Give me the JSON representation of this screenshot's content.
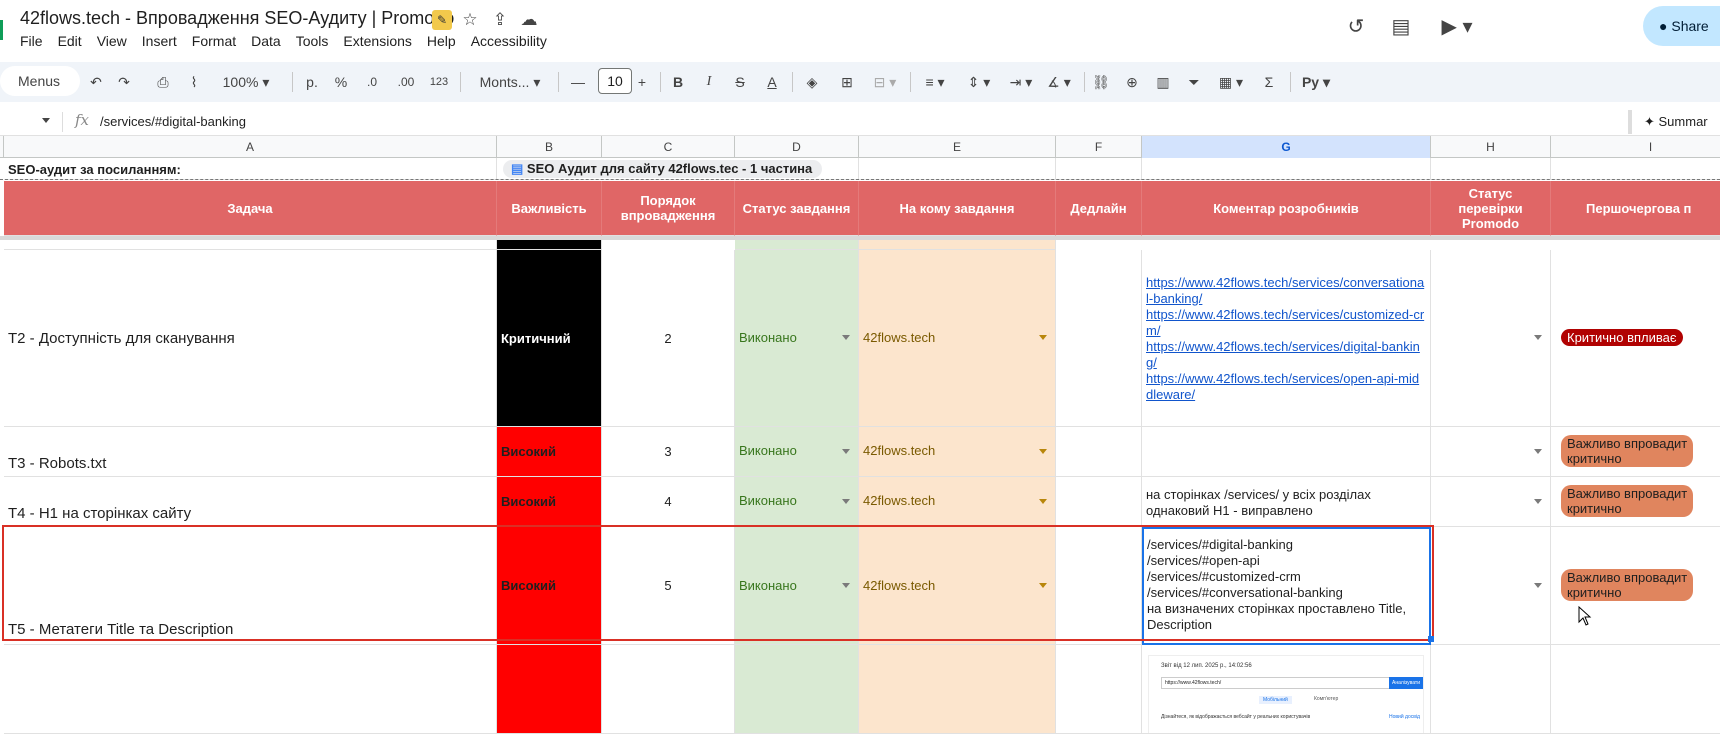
{
  "title": "42flows.tech - Впровадження SEO-Аудиту | Promodo",
  "menu": [
    "File",
    "Edit",
    "View",
    "Insert",
    "Format",
    "Data",
    "Tools",
    "Extensions",
    "Help",
    "Accessibility"
  ],
  "share_label": "Share",
  "toolbar": {
    "menus_label": "Menus",
    "zoom": "100%",
    "currency": "р.",
    "percent": "%",
    "dec_decrease": ".0",
    "dec_increase": ".00",
    "number_format": "123",
    "font": "Monts...",
    "font_size": "10",
    "minus": "—",
    "plus": "+",
    "bold": "B",
    "italic": "I",
    "strike": "S",
    "text_color": "A",
    "python": "Py"
  },
  "formula": {
    "value": "/services/#digital-banking"
  },
  "summarize_label": "Summar",
  "columns": [
    "A",
    "B",
    "C",
    "D",
    "E",
    "F",
    "G",
    "H",
    "I"
  ],
  "row1": {
    "a": "SEO-аудит за посиланням:",
    "b": "SEO Аудит для сайту 42flows.tec - 1 частина"
  },
  "headers": {
    "a": "Задача",
    "b": "Важливість",
    "c": "Порядок впровадження",
    "d": "Статус завдання",
    "e": "На кому завдання",
    "f": "Дедлайн",
    "g": "Коментар розробників",
    "h": "Статус перевірки Promodo",
    "i": "Першочергова п"
  },
  "rows": [
    {
      "task": "T2 - Доступність для сканування",
      "importance": "Критичний",
      "order": "2",
      "status": "Виконано",
      "owner": "42flows.tech",
      "comment_links": [
        "https://www.42flows.tech/services/conversational-banking/",
        "https://www.42flows.tech/services/customized-crm/",
        "https://www.42flows.tech/services/digital-banking/",
        "https://www.42flows.tech/services/open-api-middleware/"
      ],
      "priority": "Критично впливає"
    },
    {
      "task": "T3 - Robots.txt",
      "importance": "Високий",
      "order": "3",
      "status": "Виконано",
      "owner": "42flows.tech",
      "priority": "Важливо впровадит\nкритично"
    },
    {
      "task": "T4 - H1 на сторінках сайту",
      "importance": "Високий",
      "order": "4",
      "status": "Виконано",
      "owner": "42flows.tech",
      "comment": "на сторінках /services/ у всіх розділах однаковий H1 - виправлено",
      "priority": "Важливо впровадит\nкритично"
    },
    {
      "task": "T5 - Метатеги Title та Description",
      "importance": "Високий",
      "order": "5",
      "status": "Виконано",
      "owner": "42flows.tech",
      "comment": "/services/#digital-banking\n/services/#open-api\n/services/#customized-crm\n/services/#conversational-banking\nна визначених сторінках проставлено Title, Description",
      "priority": "Важливо впровадит\nкритично"
    }
  ],
  "thumbnail": {
    "caption": "Звіт від 12 лип. 2025 р., 14:02:56",
    "url": "https://www.42flows.tech/",
    "button": "Аналізувати",
    "tab1": "Мобільний",
    "tab2": "Комп'ютер",
    "note": "Дізнайтеся, як відображається вебсайт у реальних користувачів",
    "more": "Новий досвід"
  },
  "colors": {
    "header_red": "#e06666",
    "critical_black": "#000000",
    "high_red": "#ff0000",
    "status_green": "#d9ead3",
    "owner_yellow": "#fce5cd",
    "priority_pill": "#e0855e",
    "critical_pill": "#b10202"
  }
}
